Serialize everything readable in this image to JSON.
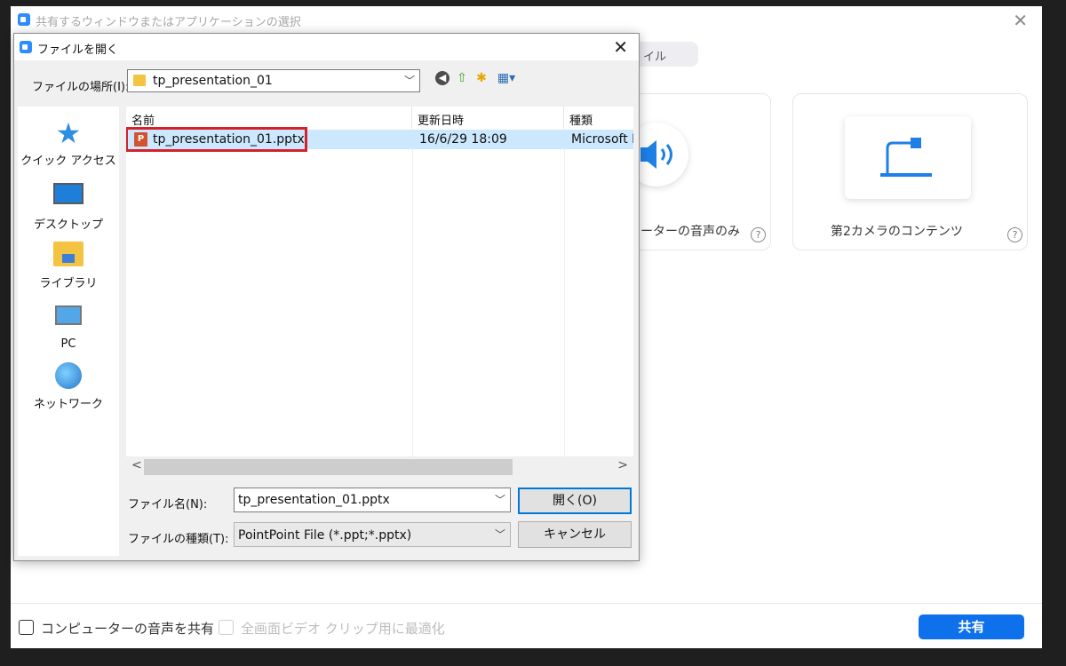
{
  "background_window": {
    "title": "共有するウィンドウまたはアプリケーションの選択",
    "close_glyph": "✕",
    "tab_partial": "イル",
    "cards": [
      {
        "label": "ーターの音声のみ",
        "icon": "speaker-icon"
      },
      {
        "label": "第2カメラのコンテンツ",
        "icon": "document-camera-icon"
      }
    ],
    "help_glyph": "?",
    "bottom": {
      "share_computer_audio_label": "コンピューターの音声を共有",
      "optimize_video_label": "全画面ビデオ クリップ用に最適化",
      "share_button_label": "共有"
    },
    "colors": {
      "accent": "#0E71EB",
      "logo": "#2D8CFF"
    }
  },
  "dialog": {
    "title": "ファイルを開く",
    "close_glyph": "✕",
    "location_label": "ファイルの場所(I):",
    "location_value": "tp_presentation_01",
    "toolbar": {
      "back_glyph": "◀",
      "up_glyph": "⇧",
      "new_folder_glyph": "✱",
      "view_glyph": "▦▾"
    },
    "places": [
      {
        "label": "クイック アクセス",
        "icon": "quick-access-star-icon"
      },
      {
        "label": "デスクトップ",
        "icon": "desktop-icon"
      },
      {
        "label": "ライブラリ",
        "icon": "libraries-icon"
      },
      {
        "label": "PC",
        "icon": "pc-icon"
      },
      {
        "label": "ネットワーク",
        "icon": "network-icon"
      }
    ],
    "columns": {
      "name": "名前",
      "date": "更新日時",
      "type": "種類"
    },
    "sort_caret": "^",
    "files": [
      {
        "icon_letter": "P",
        "name": "tp_presentation_01.pptx",
        "date": "16/6/29 18:09",
        "type": "Microsoft P"
      }
    ],
    "scroll": {
      "left_glyph": "<",
      "right_glyph": ">"
    },
    "filename_label": "ファイル名(N):",
    "filename_value": "tp_presentation_01.pptx",
    "filetype_label": "ファイルの種類(T):",
    "filetype_value": "PointPoint File (*.ppt;*.pptx)",
    "open_button": "開く(O)",
    "cancel_button": "キャンセル",
    "dropdown_glyph": "﹀",
    "colors": {
      "selection": "#cce8ff",
      "highlight": "#d2232a",
      "focus": "#0078d7"
    }
  }
}
